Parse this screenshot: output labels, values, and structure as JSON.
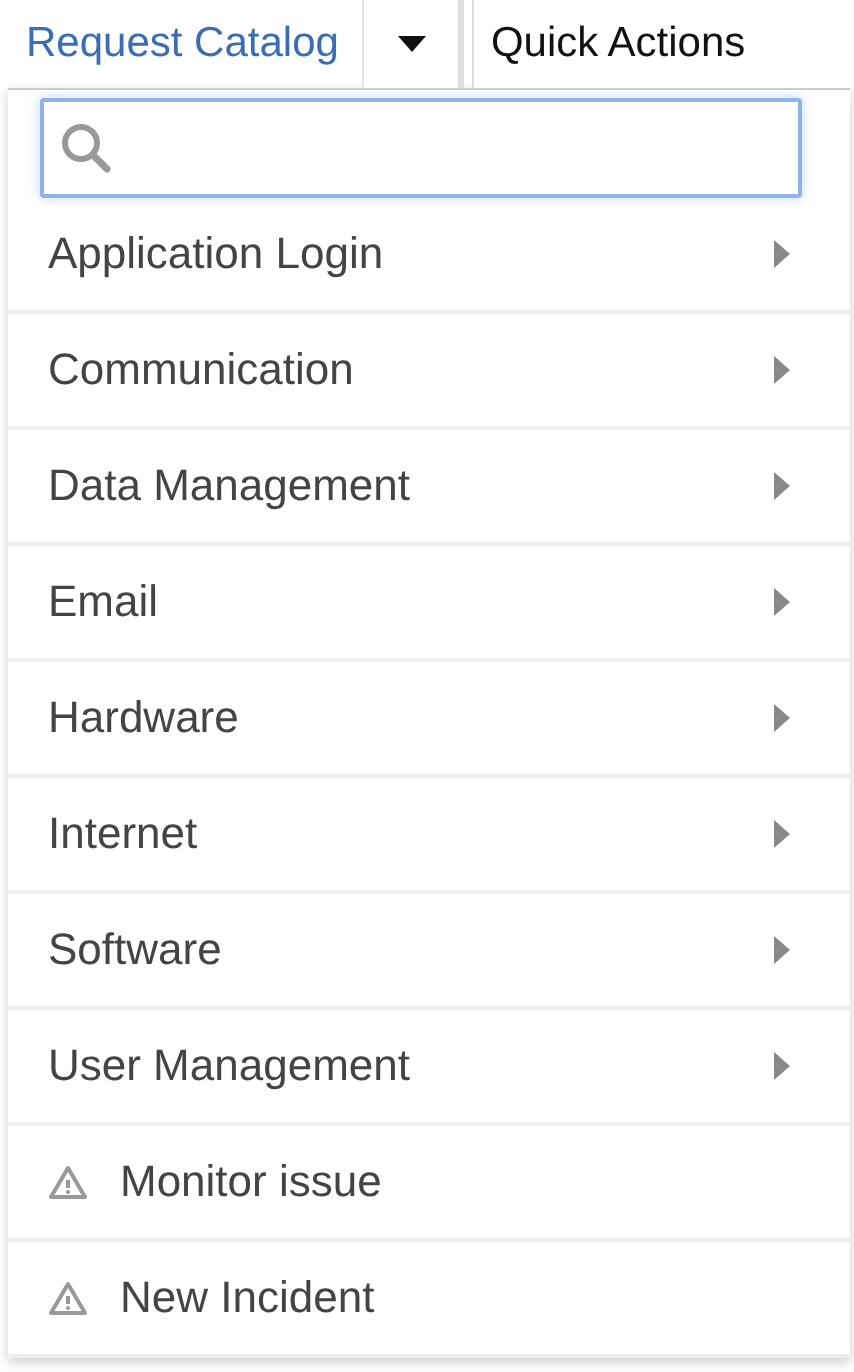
{
  "header": {
    "catalog_link": "Request Catalog",
    "quick_actions": "Quick Actions"
  },
  "items": [
    {
      "kind": "category",
      "label": "Application Login"
    },
    {
      "kind": "category",
      "label": "Communication"
    },
    {
      "kind": "category",
      "label": "Data Management"
    },
    {
      "kind": "category",
      "label": "Email"
    },
    {
      "kind": "category",
      "label": "Hardware"
    },
    {
      "kind": "category",
      "label": "Internet"
    },
    {
      "kind": "category",
      "label": "Software"
    },
    {
      "kind": "category",
      "label": "User Management"
    },
    {
      "kind": "action",
      "label": "Monitor issue"
    },
    {
      "kind": "action",
      "label": "New Incident"
    }
  ]
}
